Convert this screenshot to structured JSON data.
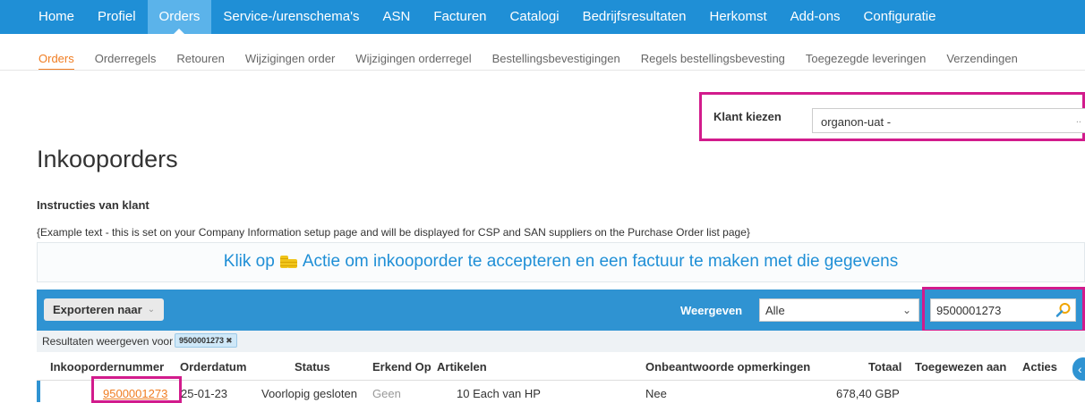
{
  "top_nav": [
    "Home",
    "Profiel",
    "Orders",
    "Service-/urenschema's",
    "ASN",
    "Facturen",
    "Catalogi",
    "Bedrijfsresultaten",
    "Herkomst",
    "Add-ons",
    "Configuratie"
  ],
  "sub_nav": [
    "Orders",
    "Orderregels",
    "Retouren",
    "Wijzigingen order",
    "Wijzigingen orderregel",
    "Bestellingsbevestigingen",
    "Regels bestellingsbevesting",
    "Toegezegde leveringen",
    "Verzendingen"
  ],
  "customer": {
    "label": "Klant kiezen",
    "value": "organon-uat -"
  },
  "page_title": "Inkooporders",
  "instructions": {
    "title": "Instructies van klant",
    "text": "{Example text - this is set on your Company Information setup page and will be displayed for CSP and SAN suppliers on the Purchase Order list page}"
  },
  "banner": {
    "before": "Klik op",
    "after": "Actie om inkooporder te accepteren en een factuur te maken met die gegevens"
  },
  "toolbar": {
    "export_label": "Exporteren naar",
    "show_label": "Weergeven",
    "show_value": "Alle",
    "search_value": "9500001273"
  },
  "filter": {
    "label": "Resultaten weergeven voor",
    "chip": "9500001273"
  },
  "table": {
    "headers": [
      "Inkoopordernummer",
      "Orderdatum",
      "Status",
      "Erkend Op",
      "Artikelen",
      "Onbeantwoorde opmerkingen",
      "Totaal",
      "Toegewezen aan",
      "Acties"
    ],
    "rows": [
      {
        "order": "9500001273",
        "date": "25-01-23",
        "status": "Voorlopig gesloten",
        "acknowledged": "Geen",
        "items": "10 Each van HP",
        "comments": "Nee",
        "total": "678,40 GBP",
        "assigned": ""
      }
    ]
  }
}
